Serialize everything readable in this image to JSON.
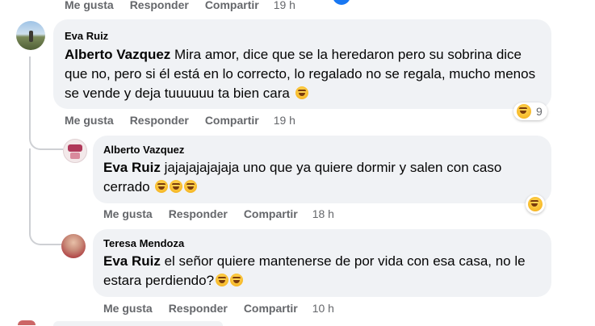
{
  "top_actions": {
    "like": "Me gusta",
    "reply": "Responder",
    "share": "Compartir",
    "time": "19 h"
  },
  "comments": [
    {
      "author": "Eva Ruiz",
      "mention": "Alberto Vazquez",
      "text": " Mira amor, dice que se la heredaron pero su sobrina dice que no, pero si él está en lo correcto, lo regalado no se regala, mucho menos se vende y deja tuuuuuu ta bien cara",
      "like": "Me gusta",
      "reply": "Responder",
      "share": "Compartir",
      "time": "19 h",
      "reaction_count": "9"
    },
    {
      "author": "Alberto Vazquez",
      "mention": "Eva Ruiz",
      "text": " jajajajajajaja uno que ya quiere dormir y salen con caso cerrado",
      "like": "Me gusta",
      "reply": "Responder",
      "share": "Compartir",
      "time": "18 h"
    },
    {
      "author": "Teresa Mendoza",
      "mention": "Eva Ruiz",
      "text": " el señor quiere mantenerse de por vida con esa casa, no le estara perdiendo?",
      "like": "Me gusta",
      "reply": "Responder",
      "share": "Compartir",
      "time": "10 h"
    }
  ],
  "colors": {
    "bubble": "#f0f2f5",
    "meta": "#65676b",
    "accent": "#1877f2"
  }
}
